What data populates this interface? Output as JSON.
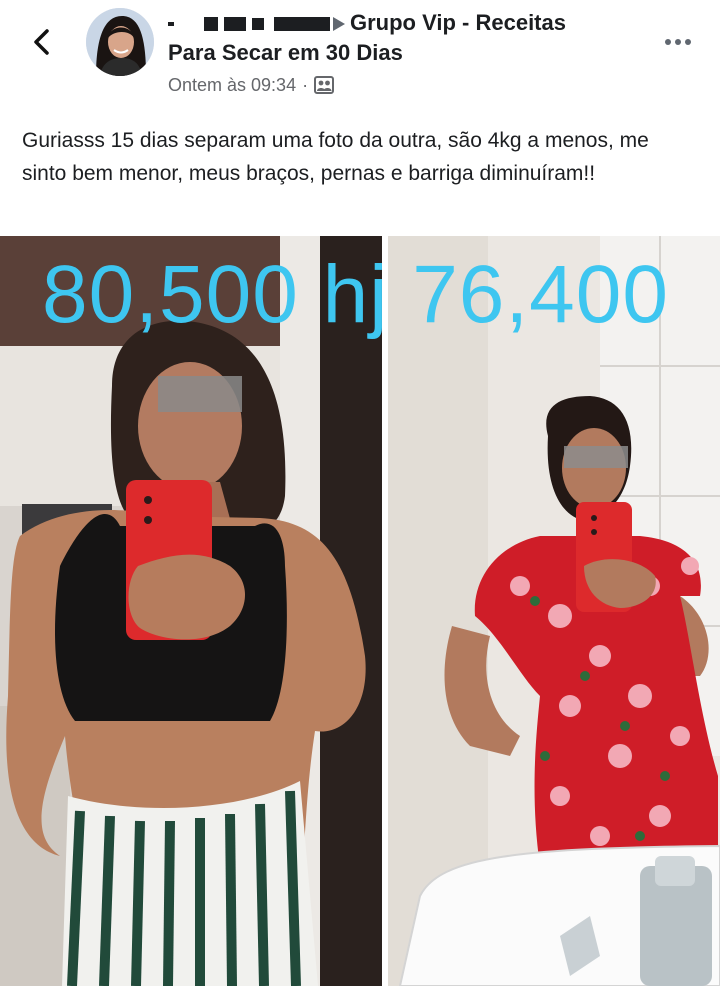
{
  "header": {
    "group_name_line1": "Grupo Vip - Receitas",
    "group_name_line2": "Para Secar em 30 Dias",
    "timestamp": "Ontem às 09:34",
    "separator": "·",
    "privacy_icon": "group-members-icon",
    "back_icon": "chevron-left-icon",
    "more_icon": "more-horizontal-icon"
  },
  "post": {
    "text": "Guriasss 15 dias separam uma foto da outra, são 4kg a menos, me sinto bem menor, meus braços,  pernas e barriga diminuíram!!"
  },
  "photo": {
    "overlay_text": "80,500 hj 76,400"
  },
  "colors": {
    "overlay_text": "#3ec6f0",
    "text_primary": "#1c1e21",
    "text_secondary": "#65676b"
  }
}
